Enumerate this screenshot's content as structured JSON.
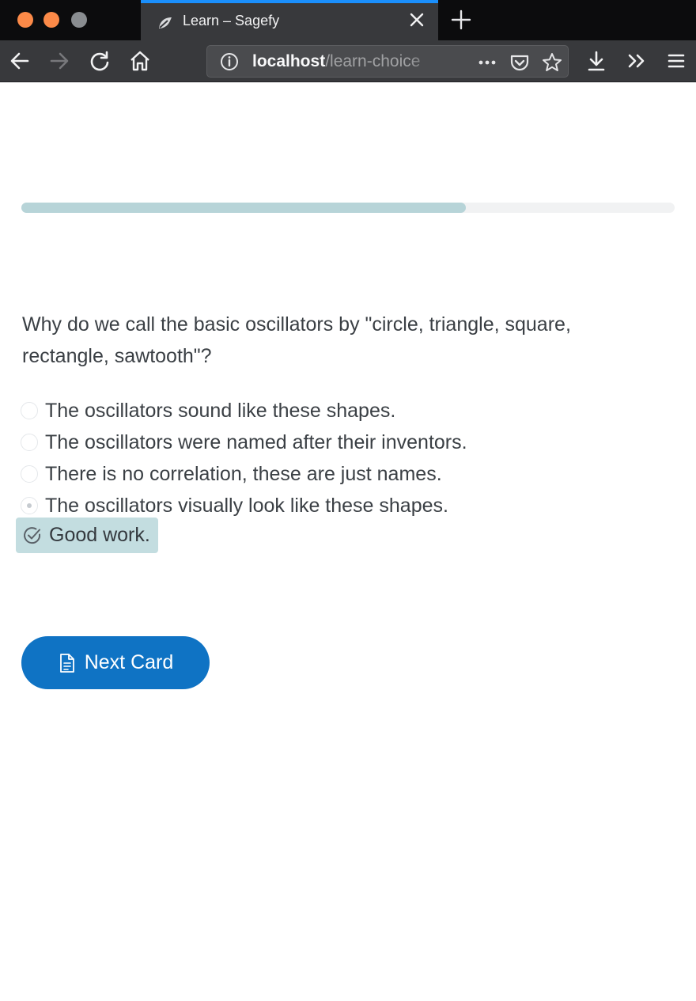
{
  "browser": {
    "tab": {
      "title": "Learn – Sagefy",
      "favicon": "sagefy-logo-icon"
    },
    "url": {
      "host": "localhost",
      "path": "/learn-choice"
    },
    "icons": [
      "back-arrow-icon",
      "forward-arrow-icon",
      "reload-icon",
      "home-icon",
      "info-icon",
      "more-dots-icon",
      "pocket-icon",
      "star-icon",
      "download-icon",
      "overflow-icon",
      "menu-icon",
      "close-icon",
      "plus-icon"
    ]
  },
  "progress": {
    "fraction": 0.68
  },
  "card": {
    "question": "Why do we call the basic oscillators by \"circle, triangle, square, rectangle, sawtooth\"?",
    "choices": [
      {
        "label": "The oscillators sound like these shapes.",
        "selected": false
      },
      {
        "label": "The oscillators were named after their inventors.",
        "selected": false
      },
      {
        "label": "There is no correlation, these are just names.",
        "selected": false
      },
      {
        "label": "The oscillators visually look like these shapes.",
        "selected": true
      }
    ],
    "feedback": {
      "text": "Good work.",
      "icon": "check-circle-icon"
    }
  },
  "actions": {
    "next_label": "Next Card",
    "next_icon": "document-icon"
  },
  "colors": {
    "accent": "#0f73c4",
    "progress": "#b7d4d8",
    "feedback_bg": "#c3dde0",
    "tab_highlight": "#1a8ffc"
  }
}
